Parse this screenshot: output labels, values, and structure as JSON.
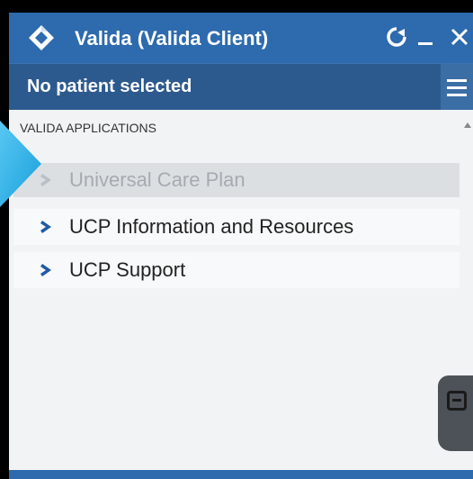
{
  "window": {
    "title": "Valida (Valida Client)",
    "icons": {
      "logo": "valida-diamond-logo",
      "refresh": "refresh-icon",
      "minimize": "minimize-icon",
      "close": "close-icon"
    }
  },
  "patient_bar": {
    "status": "No patient selected",
    "menu_icon": "hamburger-menu-icon"
  },
  "applications": {
    "header": "VALIDA APPLICATIONS",
    "items": [
      {
        "label": "Universal Care Plan",
        "state": "disabled"
      },
      {
        "label": "UCP Information and Resources",
        "state": "enabled"
      },
      {
        "label": "UCP Support",
        "state": "enabled"
      }
    ]
  },
  "colors": {
    "titlebar": "#2d6aae",
    "patientbar": "#2d5a8e",
    "accent_chevron": "#1f5aa6",
    "disabled_text": "#a6abb2",
    "pointer_cyan": "#2fb4ec"
  }
}
